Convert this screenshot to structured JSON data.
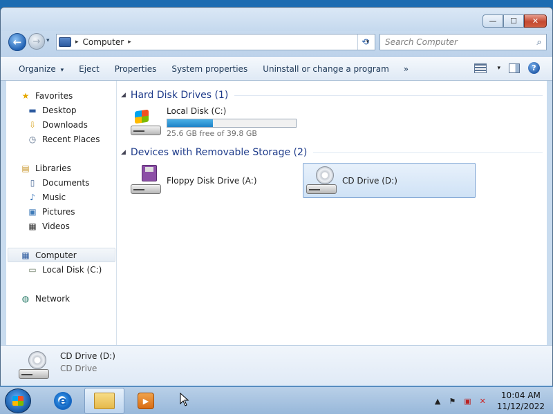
{
  "window": {
    "controls": {
      "minimize": "—",
      "maximize": "☐",
      "close": "✕"
    }
  },
  "address": {
    "back_glyph": "←",
    "forward_glyph": "→",
    "location": "Computer",
    "sep": "▸",
    "dropdown": "▾",
    "refresh_glyph": "⟲"
  },
  "search": {
    "placeholder": "Search Computer",
    "icon": "⌕"
  },
  "toolbar": {
    "organize": "Organize",
    "caret": "▾",
    "eject": "Eject",
    "properties": "Properties",
    "system_properties": "System properties",
    "uninstall": "Uninstall or change a program",
    "more": "»",
    "help": "?"
  },
  "sidebar": {
    "favorites": {
      "label": "Favorites",
      "icon": "star-icon",
      "glyph": "★"
    },
    "favorites_items": [
      {
        "label": "Desktop",
        "icon": "desktop-icon",
        "glyph": "▬"
      },
      {
        "label": "Downloads",
        "icon": "downloads-icon",
        "glyph": "⇩"
      },
      {
        "label": "Recent Places",
        "icon": "recent-places-icon",
        "glyph": "◷"
      }
    ],
    "libraries": {
      "label": "Libraries",
      "icon": "libraries-icon",
      "glyph": "▤"
    },
    "library_items": [
      {
        "label": "Documents",
        "icon": "documents-icon",
        "glyph": "▯"
      },
      {
        "label": "Music",
        "icon": "music-icon",
        "glyph": "♪"
      },
      {
        "label": "Pictures",
        "icon": "pictures-icon",
        "glyph": "▣"
      },
      {
        "label": "Videos",
        "icon": "videos-icon",
        "glyph": "▦"
      }
    ],
    "computer": {
      "label": "Computer",
      "icon": "computer-icon",
      "glyph": "▦"
    },
    "computer_items": [
      {
        "label": "Local Disk (C:)",
        "icon": "local-disk-icon",
        "glyph": "▭"
      }
    ],
    "network": {
      "label": "Network",
      "icon": "network-icon",
      "glyph": "◍"
    }
  },
  "content": {
    "caret": "◢",
    "groups": [
      {
        "title": "Hard Disk Drives (1)",
        "drives": [
          {
            "name": "Local Disk (C:)",
            "free_text": "25.6 GB free of 39.8 GB",
            "used_fraction": 0.357
          }
        ]
      },
      {
        "title": "Devices with Removable Storage (2)",
        "drives": [
          {
            "name": "Floppy Disk Drive (A:)"
          },
          {
            "name": "CD Drive (D:)"
          }
        ]
      }
    ]
  },
  "details": {
    "name": "CD Drive (D:)",
    "type": "CD Drive"
  },
  "taskbar": {
    "ie_glyph": "e",
    "media_glyph": "▶",
    "tray": {
      "up": "▲",
      "flag": "⚑",
      "network": "▣",
      "volume": "✕"
    },
    "time": "10:04 AM",
    "date": "11/12/2022"
  }
}
